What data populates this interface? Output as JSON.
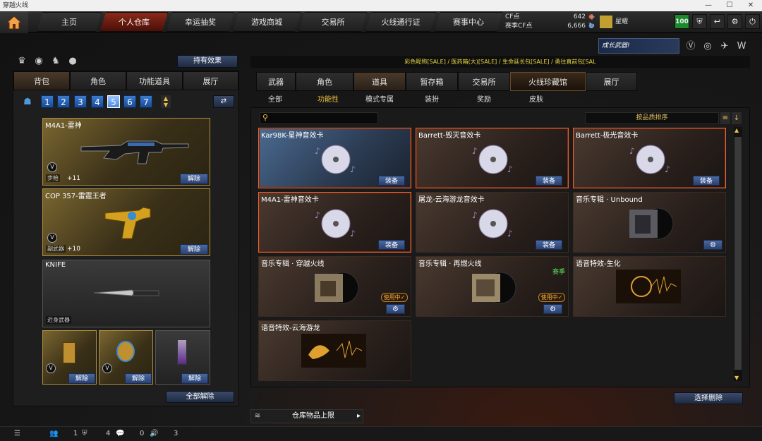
{
  "window": {
    "title": "穿越火线",
    "min": "—",
    "max": "☐",
    "close": "✕"
  },
  "nav": {
    "tabs": [
      "主页",
      "个人仓库",
      "幸运抽奖",
      "游戏商城",
      "交易所",
      "火线通行证",
      "赛事中心"
    ],
    "cf_label": "CF点",
    "cf_value": "642",
    "season_cf_label": "赛季CF点",
    "season_cf_value": "6,666",
    "plus": "+",
    "refresh": "↻",
    "rank_name": "星耀",
    "level_badge": "100"
  },
  "promo": {
    "text": "成长武器!"
  },
  "left": {
    "effects_button": "持有效果",
    "tabs": [
      "背包",
      "角色",
      "功能道具",
      "展厅"
    ],
    "pages": [
      "1",
      "2",
      "3",
      "4",
      "5",
      "6",
      "7"
    ],
    "slots": [
      {
        "name": "M4A1-雷神",
        "category": "步枪",
        "plus": "+11",
        "button": "解除"
      },
      {
        "name": "COP 357-雷霆王者",
        "category": "副武器",
        "plus": "+10",
        "button": "解除"
      },
      {
        "name": "KNIFE",
        "category": "近身武器"
      }
    ],
    "small_buttons": [
      "解除",
      "解除",
      "解除"
    ],
    "unequip_all": "全部解除"
  },
  "right": {
    "announcement": "彩色昵称[SALE] / 医药箱(大)[SALE] / 生命延长包[SALE] / 勇往直前包[SAL",
    "tabs": [
      "武器",
      "角色",
      "道具",
      "暂存箱",
      "交易所",
      "火线珍藏馆",
      "展厅"
    ],
    "subtabs": [
      "全部",
      "功能性",
      "模式专属",
      "装扮",
      "奖励",
      "皮肤"
    ],
    "sort_label": "按品质排序",
    "cards": [
      {
        "name": "Kar98K-星神音效卡",
        "button": "装备"
      },
      {
        "name": "Barrett-毁灭音效卡",
        "button": "装备"
      },
      {
        "name": "Barrett-极光音效卡",
        "button": "装备"
      },
      {
        "name": "M4A1-雷神音效卡",
        "button": "装备"
      },
      {
        "name": "屠龙-云海游龙音效卡",
        "button": "装备"
      },
      {
        "name": "音乐专辑 · Unbound",
        "gear": "⚙"
      },
      {
        "name": "音乐专辑 · 穿越火线",
        "inuse": "使用中✓",
        "gear": "⚙"
      },
      {
        "name": "音乐专辑 · 再燃火线",
        "tag": "赛季",
        "inuse": "使用中✓",
        "gear": "⚙"
      },
      {
        "name": "语音特效-生化"
      },
      {
        "name": "语音特效-云海游龙"
      }
    ],
    "delete_button": "选择删除",
    "limit_label": "仓库物品上限",
    "limit_arrow": "▸"
  },
  "footer": {
    "count1": "1",
    "count2": "4",
    "count3": "0",
    "count4": "3"
  }
}
